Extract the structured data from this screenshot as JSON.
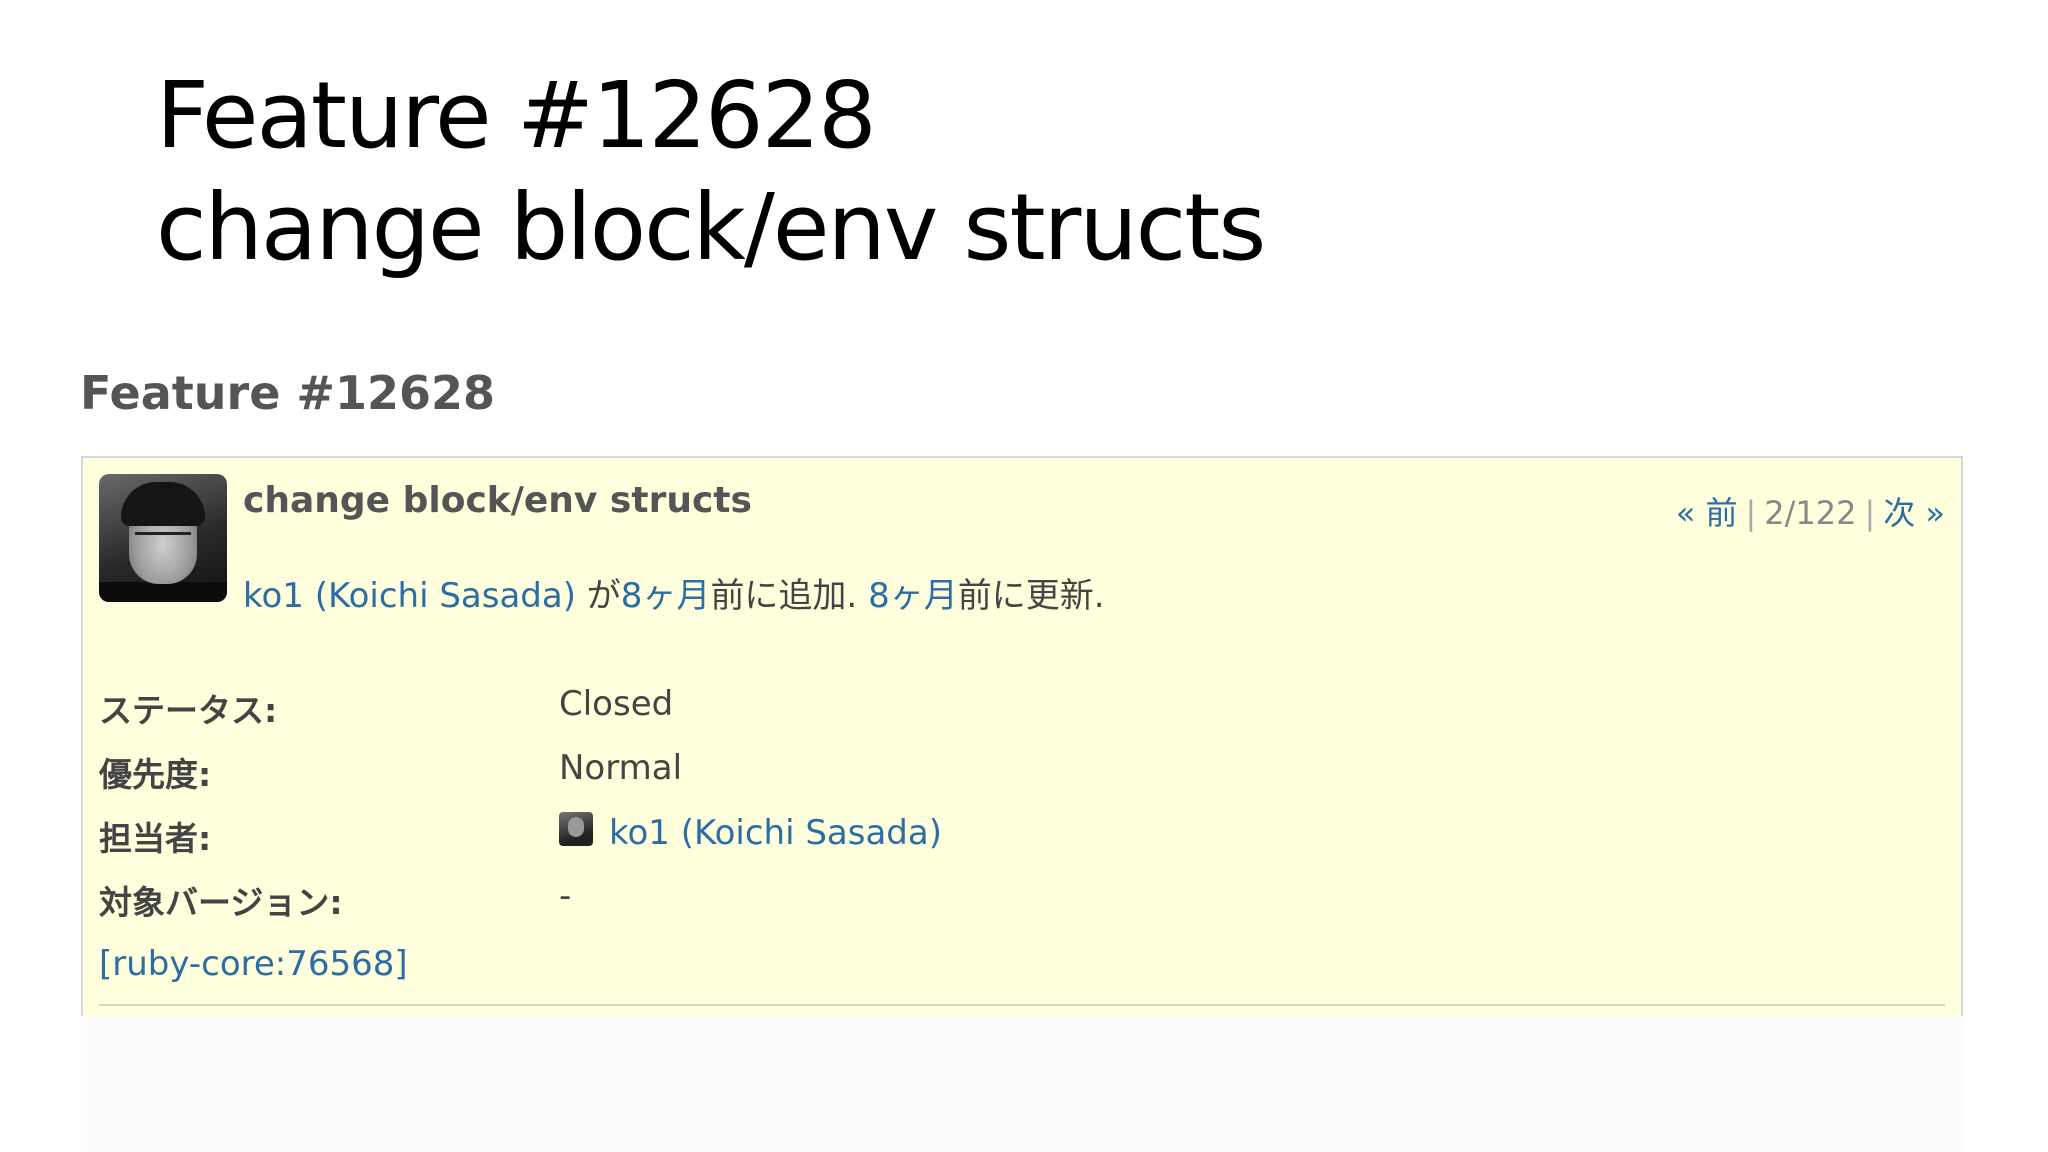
{
  "slide": {
    "title_line1": "Feature #12628",
    "title_line2": "change block/env structs"
  },
  "issue": {
    "heading": "Feature #12628",
    "subject": "change block/env structs",
    "nav": {
      "prev_label": "« 前",
      "position": "2/122",
      "next_label": "次 »"
    },
    "author_line": {
      "author": "ko1 (Koichi Sasada)",
      "text_ga": "が",
      "added_ago": "8ヶ月",
      "text_added": "前に追加.",
      "updated_ago": "8ヶ月",
      "text_updated": "前に更新."
    },
    "attributes": [
      {
        "label": "ステータス:",
        "value": "Closed"
      },
      {
        "label": "優先度:",
        "value": "Normal"
      },
      {
        "label": "担当者:",
        "value": "ko1 (Koichi Sasada)"
      },
      {
        "label": "対象バージョン:",
        "value": "-"
      }
    ],
    "reference_link": "[ruby-core:76568]"
  },
  "colors": {
    "issue_background": "#ffffdd",
    "link": "#2b6ea6",
    "heading": "#555555"
  }
}
